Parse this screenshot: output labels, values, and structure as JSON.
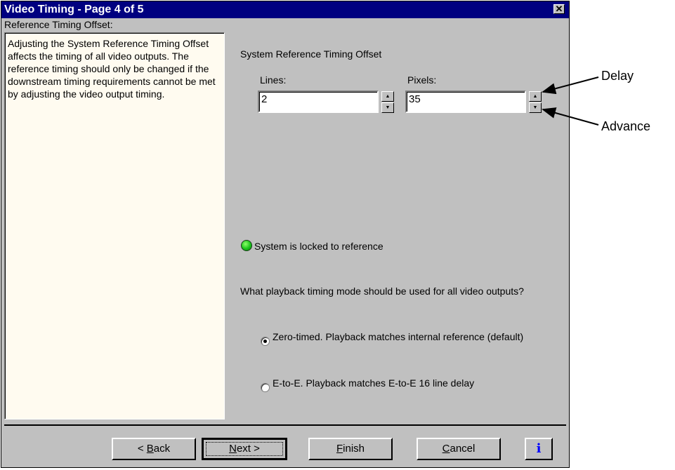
{
  "window": {
    "title": "Video Timing - Page 4 of 5",
    "close_glyph": "✕"
  },
  "section_label": "Reference Timing Offset:",
  "help_text": "Adjusting the System Reference Timing Offset affects the timing of all video outputs.  The reference timing should only be changed if the downstream timing requirements cannot be met by adjusting the video output timing.",
  "offset": {
    "group_title": "System Reference Timing Offset",
    "lines_label": "Lines:",
    "lines_value": "2",
    "pixels_label": "Pixels:",
    "pixels_value": "35",
    "spin_up_glyph": "▲",
    "spin_down_glyph": "▼"
  },
  "status": {
    "text": "System is locked to reference",
    "led_color": "#19c31a"
  },
  "playback": {
    "question": "What playback timing mode should be used for all video outputs?",
    "options": [
      {
        "label": "Zero-timed. Playback matches internal reference (default)",
        "selected": true
      },
      {
        "label": "E-to-E. Playback matches E-to-E 16 line delay",
        "selected": false
      }
    ]
  },
  "buttons": {
    "back_prefix": "< ",
    "back_key": "B",
    "back_rest": "ack",
    "next_key": "N",
    "next_rest": "ext >",
    "finish_key": "F",
    "finish_rest": "inish",
    "cancel_key": "C",
    "cancel_rest": "ancel",
    "info": "i"
  },
  "annotations": {
    "delay": "Delay",
    "advance": "Advance"
  }
}
